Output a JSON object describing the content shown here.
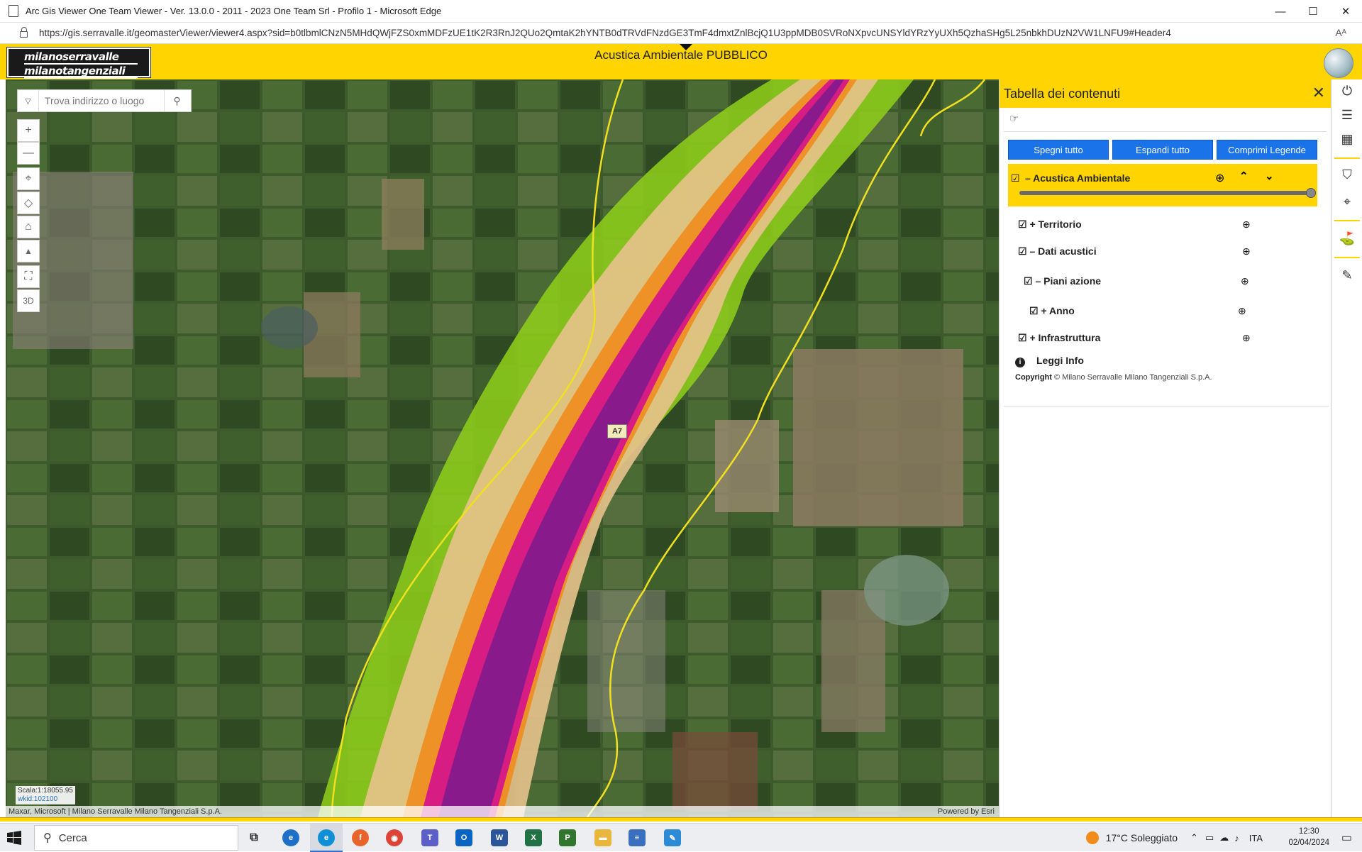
{
  "window": {
    "title": "Arc Gis Viewer One Team Viewer - Ver. 13.0.0 - 2011 - 2023 One Team Srl - Profilo 1 - Microsoft Edge",
    "minimize": "—",
    "maximize": "☐",
    "close": "✕"
  },
  "browser": {
    "url": "https://gis.serravalle.it/geomasterViewer/viewer4.aspx?sid=b0tlbmlCNzN5MHdQWjFZS0xmMDFzUE1tK2R3RnJ2QUo2QmtaK2hYNTB0dTRVdFNzdGE3TmF4dmxtZnlBcjQ1U3ppMDB0SVRoNXpvcUNSYldYRzYyUXh5QzhaSHg5L25nbkhDUzN2VW1LNFU9#Header4",
    "read_aloud": "Aᴬ"
  },
  "app": {
    "logo_line1": "milanoserravalle",
    "logo_line2": "milanotangenziali",
    "title": "Acustica Ambientale PUBBLICO"
  },
  "map": {
    "search_placeholder": "Trova indirizzo o luogo",
    "tools": {
      "zoom_in": "+",
      "zoom_out": "—",
      "locate": "⌖",
      "layers": "◇",
      "home": "⌂",
      "compass": "▲",
      "fullscreen": "⛶",
      "three_d": "3D"
    },
    "scale": "Scala:1:18055.95",
    "wkid": "wkid:102100",
    "attribution": "Maxar, Microsoft | Milano Serravalle Milano Tangenziali S.p.A.",
    "powered_by": "Powered by Esri",
    "road_label": "A7"
  },
  "toc": {
    "title": "Tabella dei contenuti",
    "close": "✕",
    "toolbar_icon": "☞",
    "buttons": [
      "Spegni tutto",
      "Espandi tutto",
      "Comprimi Legende"
    ],
    "main_layer": {
      "check": "☑",
      "label": "–  Acustica Ambientale",
      "zoom": "⊕",
      "up": "⌃",
      "down": "⌄",
      "opacity": 1.0
    },
    "layers": [
      {
        "label": "☑  +  Territorio",
        "zoom": "⊕"
      },
      {
        "label": "☑  –  Dati acustici",
        "zoom": "⊕"
      },
      {
        "label": "☑  –  Piani azione",
        "zoom": "⊕"
      },
      {
        "label": "☑  +  Anno",
        "zoom": "⊕"
      },
      {
        "label": "☑  +  Infrastruttura",
        "zoom": "⊕"
      }
    ],
    "info_label": "Leggi Info",
    "info_icon": "i",
    "copyright_label": "Copyright",
    "copyright_text": "© Milano Serravalle Milano Tangenziali S.p.A."
  },
  "tool_strip": [
    "⏻",
    "☰",
    "▦",
    "—",
    "⛉",
    "⌖",
    "—",
    "⛳",
    "—",
    "✎"
  ],
  "taskbar": {
    "search": "Cerca",
    "weather": "17°C  Soleggiato",
    "language": "ITA",
    "time": "12:30",
    "date": "02/04/2024",
    "apps": [
      "task-view",
      "edge-legacy",
      "edge",
      "firefox",
      "chrome",
      "teams",
      "outlook",
      "word",
      "excel",
      "project",
      "explorer",
      "vpn",
      "paint"
    ]
  },
  "colors": {
    "brand_yellow": "#ffd400",
    "button_blue": "#1a73e8",
    "noise_band_green": "#8fd01a",
    "noise_band_tan": "#e7c28c",
    "noise_band_orange": "#ef8d1d",
    "noise_band_magenta": "#d4108f",
    "noise_band_purple": "#7a1a8c",
    "boundary_yellow": "#f0e020"
  }
}
